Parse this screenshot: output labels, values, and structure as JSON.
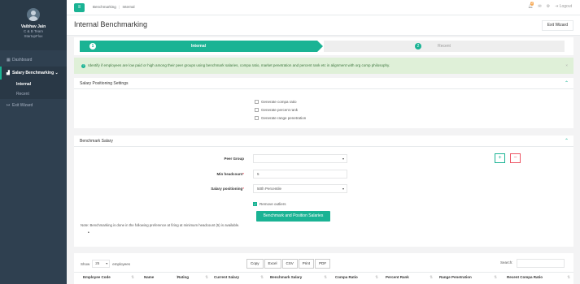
{
  "sidebar": {
    "profile": {
      "name": "Vaibhav Jain",
      "team": "C & B Team",
      "org": "StartupFlux"
    },
    "items": [
      {
        "label": "Dashboard",
        "icon": "grid-icon"
      },
      {
        "label": "Salary Benchmarking",
        "icon": "chart-icon",
        "chevron": "⌄"
      },
      {
        "label": "Exit Wizard",
        "icon": "exit-icon"
      }
    ],
    "subitems": [
      {
        "label": "Internal"
      },
      {
        "label": "Recent"
      }
    ]
  },
  "topbar": {
    "breadcrumb": {
      "first": "Benchmarking",
      "sep": "|",
      "second": "Internal"
    },
    "badge": "2",
    "logout": "Logout"
  },
  "page": {
    "title": "Internal Benchmarking",
    "exit_label": "Exit Wizard"
  },
  "wizard": {
    "steps": [
      {
        "num": "1",
        "label": "Internal"
      },
      {
        "num": "2",
        "label": "Recent"
      }
    ]
  },
  "alert": {
    "icon": "?",
    "text": "Identify if employees are low paid or high among their peer groups using benchmark salaries, compa ratio, market penetration and percent rank etc in alignment with org comp philosophy.",
    "close": "×"
  },
  "positioning": {
    "title": "Salary Positioning Settings",
    "options": [
      {
        "label": "Generate compa ratio",
        "checked": false
      },
      {
        "label": "Generate percent rank",
        "checked": false
      },
      {
        "label": "Generate range penetration",
        "checked": false
      }
    ]
  },
  "benchmark": {
    "title": "Benchmark Salary",
    "peer_group": {
      "label": "Peer Group",
      "value": ""
    },
    "min_headcount": {
      "label": "Min headcount",
      "value": "5"
    },
    "salary_positioning": {
      "label": "Salary positioning",
      "value": "50th Percentile"
    },
    "required_mark": "*",
    "remove_outliers": {
      "label": "Remove outliers",
      "checked": true
    },
    "submit": "Benchmark and Position Salaries",
    "note": "Note: Benchmarking is done in the following preference at firing at minimum headcount (5) is available.",
    "bullet": "•",
    "add": "+",
    "remove": "−"
  },
  "table": {
    "show_label": "Show",
    "page_size": "25",
    "entries_label": "employees",
    "export_buttons": [
      "Copy",
      "Excel",
      "CSV",
      "Print",
      "PDF"
    ],
    "search_label": "Search:",
    "columns": [
      "Employee Code",
      "Name",
      "Rating",
      "Current Salary",
      "Benchmark Salary",
      "Compa Ratio",
      "Percent Rank",
      "Range Penetration",
      "Recent Compa Ratio"
    ]
  },
  "colors": {
    "accent": "#1ab394",
    "sidebar": "#2f4050",
    "danger": "#ed5565"
  }
}
